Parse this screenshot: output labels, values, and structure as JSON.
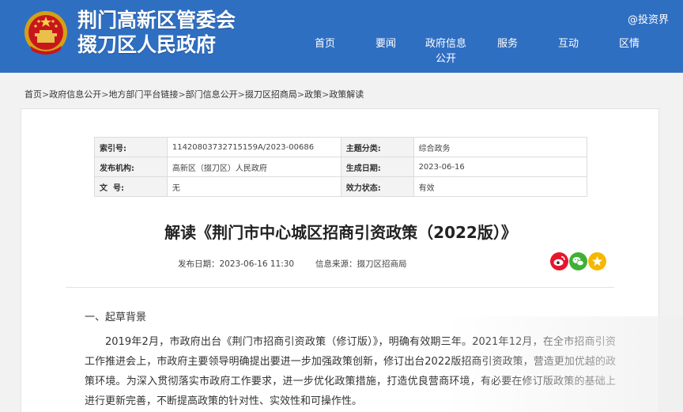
{
  "header": {
    "title_line1": "荆门高新区管委会",
    "title_line2": "掇刀区人民政府",
    "watermark": "@投资界",
    "nav": [
      {
        "label": "首页"
      },
      {
        "label": "要闻"
      },
      {
        "label": "政府信息公开"
      },
      {
        "label": "服务"
      },
      {
        "label": "互动"
      },
      {
        "label": "区情"
      }
    ]
  },
  "breadcrumb": [
    "首页",
    "政府信息公开",
    "地方部门平台链接",
    "部门信息公开",
    "掇刀区招商局",
    "政策",
    "政策解读"
  ],
  "breadcrumb_sep": ">",
  "meta": {
    "index_label": "索引号:",
    "index_value": "11420803732715159A/2023-00686",
    "topic_label": "主题分类:",
    "topic_value": "综合政务",
    "org_label": "发布机构:",
    "org_value": "高新区（掇刀区）人民政府",
    "date_label": "生成日期:",
    "date_value": "2023-06-16",
    "docno_label": "文  号:",
    "docno_value": "无",
    "status_label": "效力状态:",
    "status_value": "有效"
  },
  "article": {
    "title": "解读《荆门市中心城区招商引资政策（2022版）》",
    "publish_date": "发布日期：2023-06-16 11:30",
    "source": "信息来源：掇刀区招商局",
    "section1": "一、起草背景",
    "para1": "2019年2月，市政府出台《荆门市招商引资政策（修订版）》，明确有效期三年。2021年12月，在全市招商引资工作推进会上，市政府主要领导明确提出要进一步加强政策创新，修订出台2022版招商引资政策，营造更加优越的政策环境。为深入贯彻落实市政府工作要求，进一步优化政策措施，打造优良营商环境，有必要在修订版政策的基础上进行更新完善，不断提高政策的针对性、实效性和可操作性。"
  },
  "share": {
    "weibo_color": "#e6162d",
    "wechat_color": "#3eb135",
    "favorite_color": "#f5b800"
  },
  "colors": {
    "header_bg": "#2f6fc2",
    "page_bg": "#f2f2f2"
  }
}
